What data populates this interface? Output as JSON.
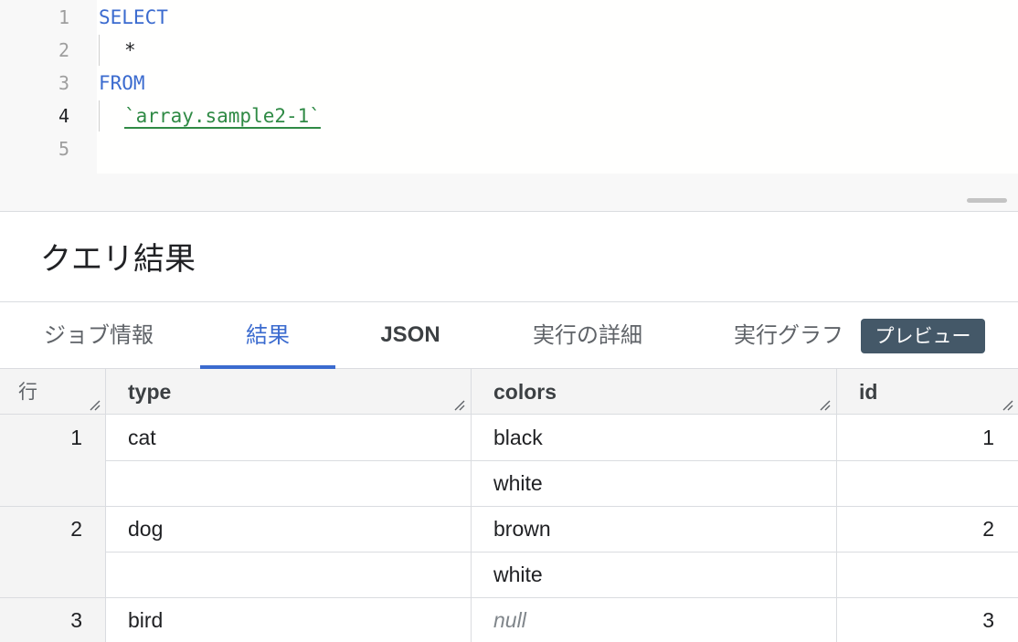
{
  "editor": {
    "line_numbers": [
      "1",
      "2",
      "3",
      "4",
      "5"
    ],
    "line1": "SELECT",
    "line2": "*",
    "line3": "FROM",
    "line4": "`array.sample2-1`"
  },
  "results": {
    "title": "クエリ結果"
  },
  "tabs": {
    "job_info": "ジョブ情報",
    "results": "結果",
    "json": "JSON",
    "execution_details": "実行の詳細",
    "execution_graph": "実行グラフ",
    "preview_badge": "プレビュー"
  },
  "table": {
    "headers": {
      "row": "行",
      "type": "type",
      "colors": "colors",
      "id": "id"
    },
    "rows": [
      {
        "row": "1",
        "type": "cat",
        "colors": [
          "black",
          "white"
        ],
        "id": "1"
      },
      {
        "row": "2",
        "type": "dog",
        "colors": [
          "brown",
          "white"
        ],
        "id": "2"
      },
      {
        "row": "3",
        "type": "bird",
        "colors": [
          "null"
        ],
        "id": "3"
      }
    ]
  }
}
